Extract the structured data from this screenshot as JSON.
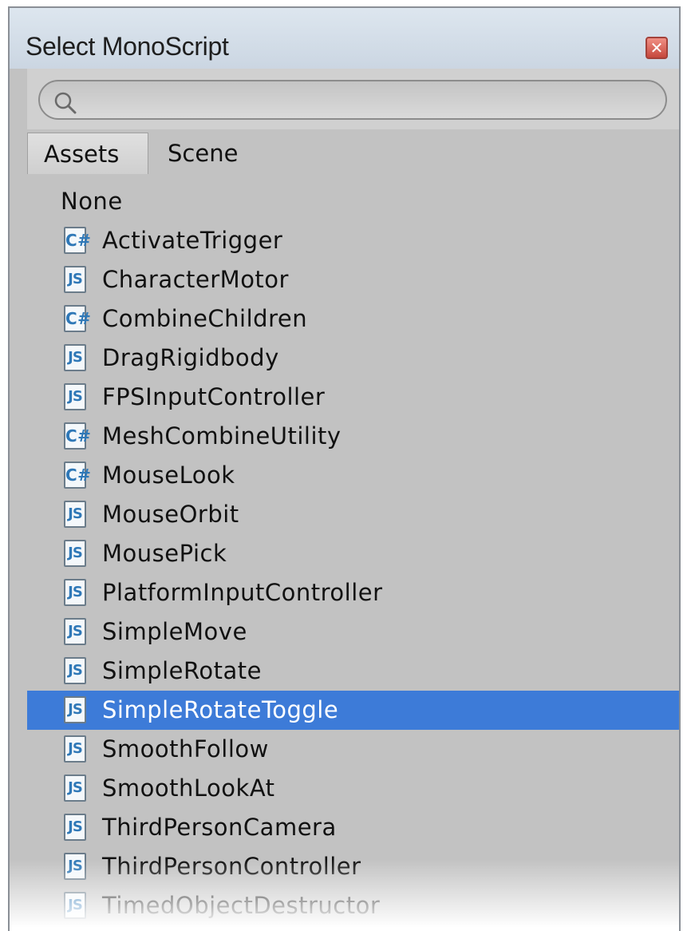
{
  "window": {
    "title": "Select MonoScript",
    "close_symbol": "✕"
  },
  "search": {
    "placeholder": "",
    "value": "",
    "icon": "search-icon"
  },
  "tabs": [
    {
      "label": "Assets",
      "active": true
    },
    {
      "label": "Scene",
      "active": false
    }
  ],
  "list": {
    "none_label": "None",
    "items": [
      {
        "label": "ActivateTrigger",
        "type": "cs",
        "icon_text": "C#"
      },
      {
        "label": "CharacterMotor",
        "type": "js",
        "icon_text": "JS"
      },
      {
        "label": "CombineChildren",
        "type": "cs",
        "icon_text": "C#"
      },
      {
        "label": "DragRigidbody",
        "type": "js",
        "icon_text": "JS"
      },
      {
        "label": "FPSInputController",
        "type": "js",
        "icon_text": "JS"
      },
      {
        "label": "MeshCombineUtility",
        "type": "cs",
        "icon_text": "C#"
      },
      {
        "label": "MouseLook",
        "type": "cs",
        "icon_text": "C#"
      },
      {
        "label": "MouseOrbit",
        "type": "js",
        "icon_text": "JS"
      },
      {
        "label": "MousePick",
        "type": "js",
        "icon_text": "JS"
      },
      {
        "label": "PlatformInputController",
        "type": "js",
        "icon_text": "JS"
      },
      {
        "label": "SimpleMove",
        "type": "js",
        "icon_text": "JS"
      },
      {
        "label": "SimpleRotate",
        "type": "js",
        "icon_text": "JS"
      },
      {
        "label": "SimpleRotateToggle",
        "type": "js",
        "icon_text": "JS",
        "selected": true
      },
      {
        "label": "SmoothFollow",
        "type": "js",
        "icon_text": "JS"
      },
      {
        "label": "SmoothLookAt",
        "type": "js",
        "icon_text": "JS"
      },
      {
        "label": "ThirdPersonCamera",
        "type": "js",
        "icon_text": "JS"
      },
      {
        "label": "ThirdPersonController",
        "type": "js",
        "icon_text": "JS"
      },
      {
        "label": "TimedObjectDestructor",
        "type": "js",
        "icon_text": "JS"
      }
    ]
  },
  "colors": {
    "selection": "#3d7bd8",
    "panel": "#c2c2c2",
    "icon_accent": "#2f78b7"
  }
}
